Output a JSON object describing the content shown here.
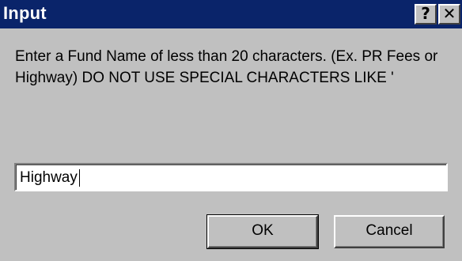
{
  "window": {
    "title": "Input",
    "help_glyph": "?",
    "close_glyph": "✕"
  },
  "prompt": {
    "text": "Enter a Fund Name of less than 20 characters. (Ex. PR Fees or Highway) DO NOT USE SPECIAL CHARACTERS LIKE '"
  },
  "input": {
    "value": "Highway"
  },
  "buttons": {
    "ok_label": "OK",
    "cancel_label": "Cancel"
  },
  "colors": {
    "titlebar": "#0a246a",
    "face": "#c0c0c0"
  }
}
